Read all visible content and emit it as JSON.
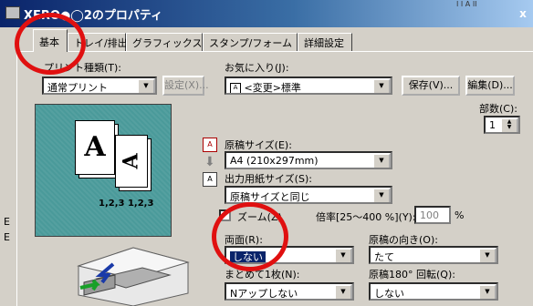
{
  "window": {
    "title": "XERO●◯2のプロパティ",
    "top_strip": "I I A II"
  },
  "tabs": [
    {
      "label": "基本"
    },
    {
      "label": "トレイ/排出"
    },
    {
      "label": "グラフィックス"
    },
    {
      "label": "スタンプ/フォーム"
    },
    {
      "label": "詳細設定"
    }
  ],
  "print_type": {
    "label": "プリント種類(T):",
    "value": "通常プリント",
    "settings_button": "設定(X)..."
  },
  "favorites": {
    "label": "お気に入り(J):",
    "value": "<変更>標準",
    "save_button": "保存(V)...",
    "edit_button": "編集(D)..."
  },
  "copies": {
    "label": "部数(C):",
    "value": "1"
  },
  "preview": {
    "page_letter": "A",
    "page_letter_rotated": "A",
    "order_label": "1,2,3  1,2,3"
  },
  "original_size": {
    "label": "原稿サイズ(E):",
    "value": "A4 (210x297mm)"
  },
  "output_size": {
    "label": "出力用紙サイズ(S):",
    "value": "原稿サイズと同じ"
  },
  "zoom": {
    "label": "ズーム(Z)",
    "ratio_label": "倍率[25〜400 %](Y):",
    "ratio_value": "100",
    "unit": "%"
  },
  "duplex": {
    "label": "両面(R):",
    "value": "しない"
  },
  "orientation": {
    "label": "原稿の向き(O):",
    "value": "たて"
  },
  "nup": {
    "label": "まとめて1枚(N):",
    "value": "Nアップしない"
  },
  "rotate180": {
    "label": "原稿180° 回転(Q):",
    "value": "しない"
  },
  "left_edge_labels": [
    "E",
    "E"
  ],
  "colors": {
    "title_start": "#0a246a",
    "face": "#d4d0c8",
    "preview_bg": "#4a9a9a",
    "highlight": "#e01010"
  }
}
